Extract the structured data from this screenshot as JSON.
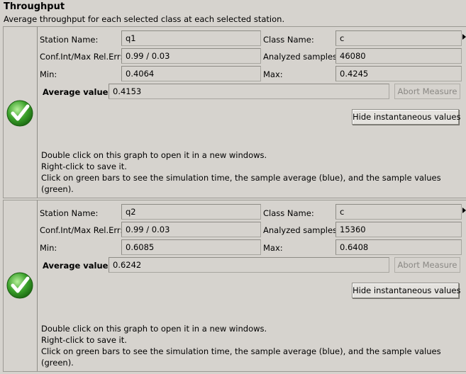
{
  "header": {
    "title": "Throughput",
    "subtitle": "Average throughput for each selected class at each selected station."
  },
  "panels": [
    {
      "station_label": "Station Name:",
      "station_value": "q1",
      "class_label": "Class Name:",
      "class_value": "c",
      "conf_label": "Conf.Int/Max Rel.Err:",
      "conf_value": "0.99 / 0.03",
      "samples_label": "Analyzed samples:",
      "samples_value": "46080",
      "min_label": "Min:",
      "min_value": "0.4064",
      "max_label": "Max:",
      "max_value": "0.4245",
      "avg_label": "Average value:",
      "avg_value": "0.4153",
      "abort_label": "Abort Measure",
      "hide_label": "Hide instantaneous values",
      "info_lines": [
        "Double click on this graph to open it in a new windows.",
        "Right-click to save it.",
        "Click on green bars to see the simulation time, the sample average (blue), and the sample values (green)."
      ]
    },
    {
      "station_label": "Station Name:",
      "station_value": "q2",
      "class_label": "Class Name:",
      "class_value": "c",
      "conf_label": "Conf.Int/Max Rel.Err:",
      "conf_value": "0.99 / 0.03",
      "samples_label": "Analyzed samples:",
      "samples_value": "15360",
      "min_label": "Min:",
      "min_value": "0.6085",
      "max_label": "Max:",
      "max_value": "0.6408",
      "avg_label": "Average value:",
      "avg_value": "0.6242",
      "abort_label": "Abort Measure",
      "hide_label": "Hide instantaneous values",
      "info_lines": [
        "Double click on this graph to open it in a new windows.",
        "Right-click to save it.",
        "Click on green bars to see the simulation time, the sample average (blue), and the sample values (green)."
      ]
    }
  ],
  "colors": {
    "check_green": "#3aa02a",
    "background": "#d6d3ce"
  }
}
